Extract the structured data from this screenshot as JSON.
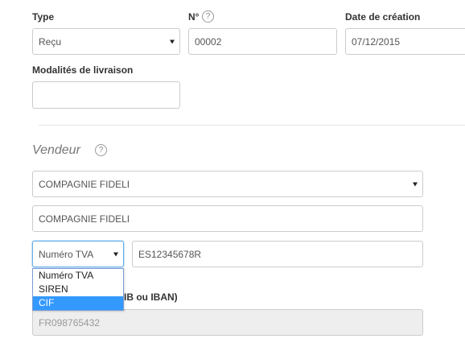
{
  "form": {
    "type": {
      "label": "Type",
      "value": "Reçu"
    },
    "number": {
      "label": "N°",
      "help": "?",
      "value": "00002"
    },
    "creation_date": {
      "label": "Date de création",
      "value": "07/12/2015"
    },
    "delivery": {
      "label": "Modalités de livraison",
      "value": ""
    }
  },
  "vendor": {
    "title": "Vendeur",
    "help": "?",
    "company_select": "COMPAGNIE FIDELI",
    "company_name": "COMPAGNIE FIDELI",
    "id_type": "Numéro TVA",
    "id_value": "ES12345678R",
    "id_options": [
      "Numéro TVA",
      "SIREN",
      "CIF"
    ],
    "id_options_highlighted": "CIF",
    "bank_label_partial": "IB ou IBAN)",
    "bank_value": "FR098765432"
  }
}
